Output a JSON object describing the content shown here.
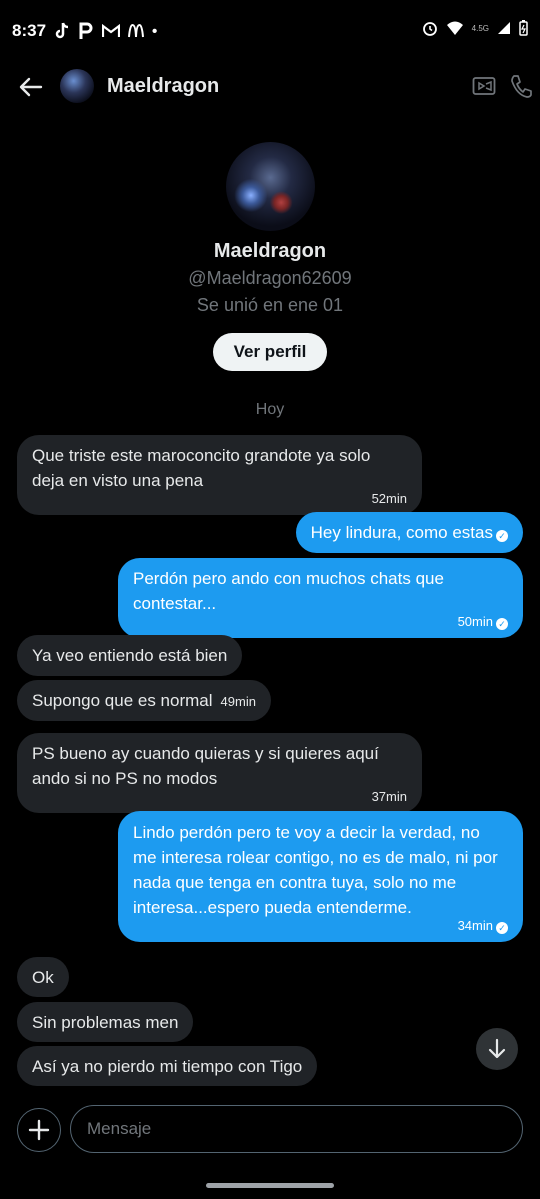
{
  "status_bar": {
    "time": "8:37",
    "network": "4.5G",
    "left_icons": [
      "tiktok-icon",
      "p-app-icon",
      "gmail-icon",
      "mcdonalds-icon",
      "dot-icon"
    ],
    "right_icons": [
      "alarm-icon",
      "wifi-icon",
      "signal-icon",
      "battery-icon"
    ]
  },
  "header": {
    "name": "Maeldragon"
  },
  "profile": {
    "name": "Maeldragon",
    "handle": "@Maeldragon62609",
    "joined": "Se unió en ene 01",
    "view_profile_label": "Ver perfil"
  },
  "day_separator": "Hoy",
  "messages": [
    {
      "dir": "in",
      "text": "Que triste este maroconcito grandote ya solo deja en visto una pena",
      "time": "52min"
    },
    {
      "dir": "out",
      "text": "Hey lindura, como estas",
      "time": ""
    },
    {
      "dir": "out",
      "text": "Perdón pero ando con muchos chats que contestar...",
      "time": "50min"
    },
    {
      "dir": "in",
      "text": "Ya veo entiendo está bien",
      "time": ""
    },
    {
      "dir": "in",
      "text": "Supongo que es normal",
      "time": "49min"
    },
    {
      "dir": "in",
      "text": "PS bueno ay cuando quieras y si quieres aquí ando si no PS no modos",
      "time": "37min"
    },
    {
      "dir": "out",
      "text": "Lindo perdón pero te voy a decir la verdad, no me interesa rolear contigo, no es de malo, ni por nada que tenga en contra tuya, solo no me interesa...espero pueda entenderme.",
      "time": "34min"
    },
    {
      "dir": "in",
      "text": "Ok",
      "time": ""
    },
    {
      "dir": "in",
      "text": "Sin problemas men",
      "time": ""
    },
    {
      "dir": "in",
      "text": "Así ya no pierdo mi tiempo con Tigo",
      "time": ""
    }
  ],
  "composer": {
    "placeholder": "Mensaje"
  },
  "colors": {
    "background": "#000000",
    "incoming_bubble": "#202327",
    "outgoing_bubble": "#1d9bf0",
    "secondary_text": "#71767b"
  }
}
